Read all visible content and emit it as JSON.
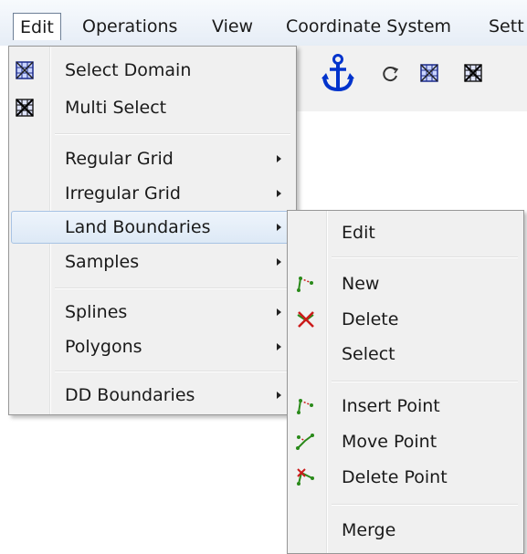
{
  "menubar": {
    "items": [
      {
        "label": "Edit"
      },
      {
        "label": "Operations"
      },
      {
        "label": "View"
      },
      {
        "label": "Coordinate System"
      },
      {
        "label": "Sett"
      }
    ]
  },
  "edit_menu": {
    "items": [
      {
        "label": "Select Domain",
        "icon": "select-domain-icon"
      },
      {
        "label": "Multi Select",
        "icon": "multi-select-icon"
      },
      {
        "label": "Regular Grid",
        "submenu": true
      },
      {
        "label": "Irregular Grid",
        "submenu": true
      },
      {
        "label": "Land Boundaries",
        "submenu": true,
        "highlighted": true
      },
      {
        "label": "Samples",
        "submenu": true
      },
      {
        "label": "Splines",
        "submenu": true
      },
      {
        "label": "Polygons",
        "submenu": true
      },
      {
        "label": "DD Boundaries",
        "submenu": true
      }
    ]
  },
  "land_boundaries_menu": {
    "items": [
      {
        "label": "Edit"
      },
      {
        "label": "New",
        "icon": "new-line-icon"
      },
      {
        "label": "Delete",
        "icon": "delete-x-icon"
      },
      {
        "label": "Select"
      },
      {
        "label": "Insert Point",
        "icon": "insert-point-icon"
      },
      {
        "label": "Move Point",
        "icon": "move-point-icon"
      },
      {
        "label": "Delete Point",
        "icon": "delete-point-icon"
      },
      {
        "label": "Merge"
      }
    ]
  },
  "colors": {
    "accent": "#0033cc",
    "highlight": "#dde9f6",
    "icon_green": "#2a8a1a",
    "icon_red": "#cc1a1a"
  }
}
